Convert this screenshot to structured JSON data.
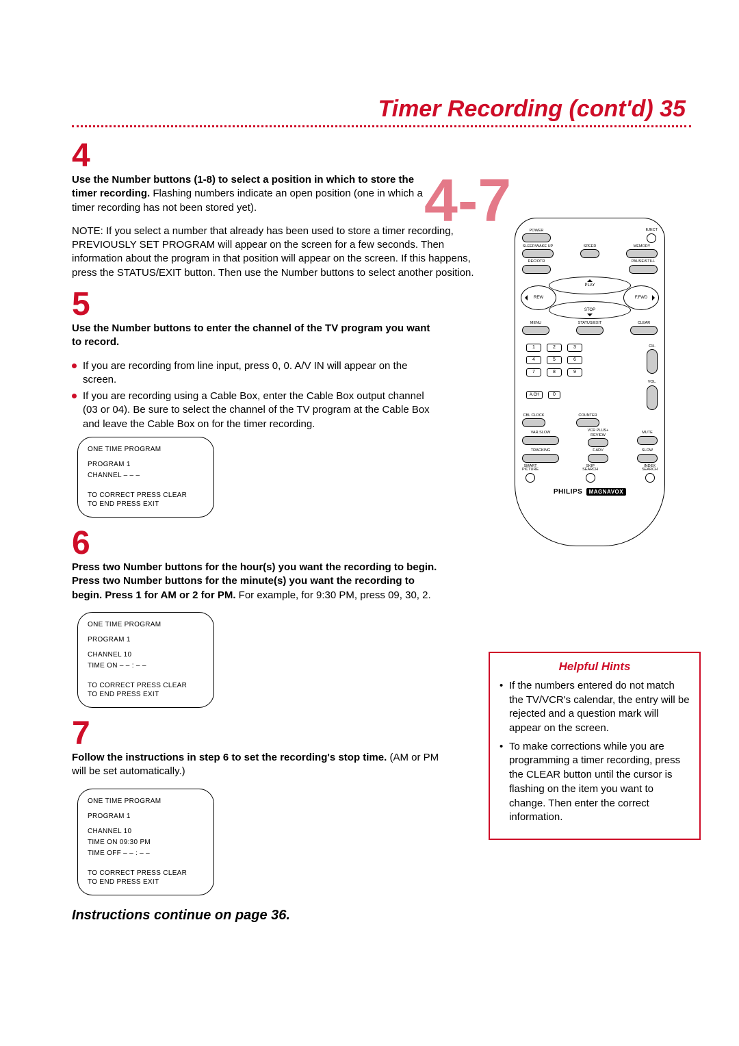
{
  "page": {
    "title": "Timer Recording (cont'd)  35",
    "continue_text": "Instructions continue on page 36.",
    "big_range": "4-7"
  },
  "steps": {
    "s4": {
      "num": "4",
      "bold": "Use the Number buttons (1-8) to select a position in which to store the timer recording.",
      "rest": " Flashing numbers indicate an open position (one in which a timer recording has not been stored yet).",
      "note": "NOTE: If you select a number that already has been used to store a timer recording, PREVIOUSLY SET PROGRAM will appear on the screen for a few seconds. Then information about the program in that position will appear on the screen. If this happens, press the STATUS/EXIT button. Then use the Number buttons to select another position."
    },
    "s5": {
      "num": "5",
      "bold": "Use the Number buttons to enter the channel of the TV program you want to record.",
      "b1": "If you are recording from line input, press 0, 0. A/V IN will appear on the screen.",
      "b2": "If you are recording using a Cable Box, enter the Cable Box output channel (03 or 04). Be sure to select the channel of the TV program at the Cable Box and leave the Cable Box on for the timer recording."
    },
    "s6": {
      "num": "6",
      "bold": "Press two Number buttons for the hour(s) you want the recording to begin. Press two Number buttons for the minute(s) you want the recording to begin. Press 1 for AM or 2 for PM.",
      "rest": " For example, for 9:30 PM, press 09, 30, 2."
    },
    "s7": {
      "num": "7",
      "bold": "Follow the instructions in step 6 to set the recording's stop time.",
      "rest": " (AM or PM will be set automatically.)"
    }
  },
  "osd": {
    "title": "ONE TIME PROGRAM",
    "program": "PROGRAM    1",
    "ch_blank": "CHANNEL   – – –",
    "ch_10": "CHANNEL    10",
    "time_on_blank": "TIME ON      – – : – –",
    "time_on_val": "TIME ON      09:30 PM",
    "time_off_blank": "TIME OFF    – – : – –",
    "footer1": "TO CORRECT PRESS CLEAR",
    "footer2": "TO END PRESS EXIT"
  },
  "remote": {
    "power": "POWER",
    "eject": "EJECT",
    "sleep": "SLEEP/WAKE UP",
    "speed": "SPEED",
    "memory": "MEMORY",
    "recotr": "REC/OTR",
    "pause": "PAUSE/STILL",
    "play": "PLAY",
    "stop": "STOP",
    "rew": "REW",
    "ffwd": "F.FWD",
    "menu": "MENU",
    "status": "STATUS/EXIT",
    "clear": "CLEAR",
    "ch": "CH.",
    "vol": "VOL.",
    "ach": "A.CH",
    "n": [
      "1",
      "2",
      "3",
      "4",
      "5",
      "6",
      "7",
      "8",
      "9",
      "0"
    ],
    "cblclock": "CBL CLOCK",
    "counter": "COUNTER",
    "varslow": "VAR.SLOW",
    "vcrplus": "VCR PLUS+",
    "review": "REVIEW",
    "mute": "MUTE",
    "tracking": "TRACKING",
    "fadv": "F.ADV",
    "slow": "SLOW",
    "smart": "SMART\nPICTURE",
    "skip": "SKIP\nSEARCH",
    "index": "INDEX\nSEARCH",
    "brand": "PHILIPS",
    "brand2": "MAGNAVOX"
  },
  "hints": {
    "title": "Helpful Hints",
    "h1": "If the numbers entered do not match the TV/VCR's calendar, the entry will be rejected and a question mark will appear on the screen.",
    "h2": "To make corrections while you are programming a timer recording, press the CLEAR button until the cursor is flashing on the item you want to change. Then enter the correct information."
  }
}
